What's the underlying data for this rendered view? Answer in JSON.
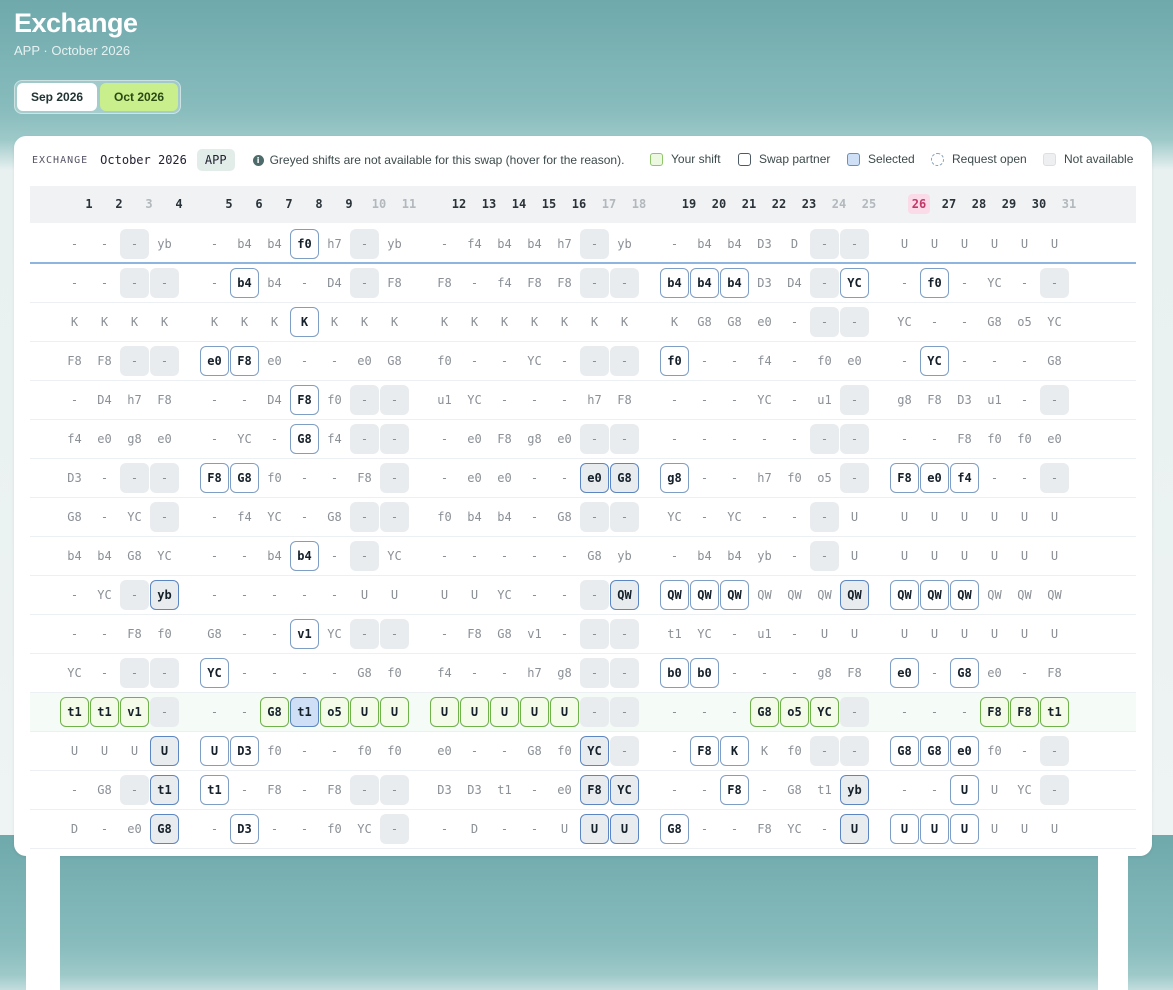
{
  "app": {
    "title": "Exchange",
    "subtitle": "APP · October 2026"
  },
  "month_tabs": [
    {
      "label": "Sep 2026",
      "active": false
    },
    {
      "label": "Oct 2026",
      "active": true
    }
  ],
  "toolbar": {
    "label": "EXCHANGE",
    "month": "October 2026",
    "team": "APP",
    "note": "Greyed shifts are not available for this swap (hover for the reason)."
  },
  "legend": [
    {
      "label": "Your shift",
      "kind": "yours"
    },
    {
      "label": "Swap partner",
      "kind": "partner"
    },
    {
      "label": "Selected",
      "kind": "selected"
    },
    {
      "label": "Request open",
      "kind": "request"
    },
    {
      "label": "Not available",
      "kind": "na"
    }
  ],
  "colors": {
    "accent": "#c9ee8c",
    "today": "#fbdbe7",
    "selected": "#cfe0f6",
    "your_shift_border": "#6fb24a",
    "partner_border": "#7f9ec4"
  },
  "days": [
    {
      "d": "1"
    },
    {
      "d": "2"
    },
    {
      "d": "3",
      "we": true
    },
    {
      "d": "4"
    },
    {
      "d": "5"
    },
    {
      "d": "6"
    },
    {
      "d": "7"
    },
    {
      "d": "8"
    },
    {
      "d": "9"
    },
    {
      "d": "10",
      "we": true
    },
    {
      "d": "11",
      "we": true
    },
    {
      "d": "12"
    },
    {
      "d": "13"
    },
    {
      "d": "14"
    },
    {
      "d": "15"
    },
    {
      "d": "16"
    },
    {
      "d": "17",
      "we": true
    },
    {
      "d": "18",
      "we": true
    },
    {
      "d": "19"
    },
    {
      "d": "20"
    },
    {
      "d": "21"
    },
    {
      "d": "22"
    },
    {
      "d": "23"
    },
    {
      "d": "24",
      "we": true
    },
    {
      "d": "25",
      "we": true
    },
    {
      "d": "26",
      "today": true
    },
    {
      "d": "27"
    },
    {
      "d": "28"
    },
    {
      "d": "29"
    },
    {
      "d": "30"
    },
    {
      "d": "31",
      "we": true
    }
  ],
  "rows": [
    {
      "cells": [
        "-",
        "-",
        "-:n",
        "yb",
        "-",
        "b4",
        "b4",
        "f0:p",
        "h7",
        "-:n",
        "yb",
        "-",
        "f4",
        "b4",
        "b4",
        "h7",
        "-:n",
        "yb",
        "-",
        "b4",
        "b4",
        "D3",
        "D",
        "-:n",
        "-:n",
        "U",
        "U",
        "U",
        "U",
        "U",
        "U"
      ]
    },
    {
      "cells": [
        "-",
        "-",
        "-:n",
        "-:n",
        "-",
        "b4:p",
        "b4",
        "-",
        "D4",
        "-:n",
        "F8",
        "F8",
        "-",
        "f4",
        "F8",
        "F8",
        "-:n",
        "-:n",
        "b4:p",
        "b4:p",
        "b4:p",
        "D3",
        "D4",
        "-:n",
        "YC:p",
        "-",
        "f0:p",
        "-",
        "YC",
        "-",
        "-:n"
      ]
    },
    {
      "cells": [
        "K",
        "K",
        "K",
        "K",
        "K",
        "K",
        "K",
        "K:p",
        "K",
        "K",
        "K",
        "K",
        "K",
        "K",
        "K",
        "K",
        "K",
        "K",
        "K",
        "G8",
        "G8",
        "e0",
        "-",
        "-:n",
        "-:n",
        "YC",
        "-",
        "-",
        "G8",
        "o5",
        "YC"
      ]
    },
    {
      "cells": [
        "F8",
        "F8",
        "-:n",
        "-:n",
        "e0:p",
        "F8:p",
        "e0",
        "-",
        "-",
        "e0",
        "G8",
        "f0",
        "-",
        "-",
        "YC",
        "-",
        "-:n",
        "-:n",
        "f0:p",
        "-",
        "-",
        "f4",
        "-",
        "f0",
        "e0",
        "-",
        "YC:p",
        "-",
        "-",
        "-",
        "G8"
      ]
    },
    {
      "cells": [
        "-",
        "D4",
        "h7",
        "F8",
        "-",
        "-",
        "D4",
        "F8:p",
        "f0",
        "-:n",
        "-:n",
        "u1",
        "YC",
        "-",
        "-",
        "-",
        "h7",
        "F8",
        "-",
        "-",
        "-",
        "YC",
        "-",
        "u1",
        "-:n",
        "g8",
        "F8",
        "D3",
        "u1",
        "-",
        "-:n"
      ]
    },
    {
      "cells": [
        "f4",
        "e0",
        "g8",
        "e0",
        "-",
        "YC",
        "-",
        "G8:p",
        "f4",
        "-:n",
        "-:n",
        "-",
        "e0",
        "F8",
        "g8",
        "e0",
        "-:n",
        "-:n",
        "-",
        "-",
        "-",
        "-",
        "-",
        "-:n",
        "-:n",
        "-",
        "-",
        "F8",
        "f0",
        "f0",
        "e0"
      ]
    },
    {
      "cells": [
        "D3",
        "-",
        "-:n",
        "-:n",
        "F8:p",
        "G8:p",
        "f0",
        "-",
        "-",
        "F8",
        "-:n",
        "-",
        "e0",
        "e0",
        "-",
        "-",
        "e0:s",
        "G8:s",
        "g8:p",
        "-",
        "-",
        "h7",
        "f0",
        "o5",
        "-:n",
        "F8:p",
        "e0:p",
        "f4:p",
        "-",
        "-",
        "-:n"
      ]
    },
    {
      "cells": [
        "G8",
        "-",
        "YC",
        "-:n",
        "-",
        "f4",
        "YC",
        "-",
        "G8",
        "-:n",
        "-:n",
        "f0",
        "b4",
        "b4",
        "-",
        "G8",
        "-:n",
        "-:n",
        "YC",
        "-",
        "YC",
        "-",
        "-",
        "-:n",
        "U",
        "U",
        "U",
        "U",
        "U",
        "U",
        "U"
      ]
    },
    {
      "cells": [
        "b4",
        "b4",
        "G8",
        "YC",
        "-",
        "-",
        "b4",
        "b4:p",
        "-",
        "-:n",
        "YC",
        "-",
        "-",
        "-",
        "-",
        "-",
        "G8",
        "yb",
        "-",
        "b4",
        "b4",
        "yb",
        "-",
        "-:n",
        "U",
        "U",
        "U",
        "U",
        "U",
        "U",
        "U"
      ]
    },
    {
      "cells": [
        "-",
        "YC",
        "-:n",
        "yb:s",
        "-",
        "-",
        "-",
        "-",
        "-",
        "U",
        "U",
        "U",
        "U",
        "YC",
        "-",
        "-",
        "-:n",
        "QW:s",
        "QW:p",
        "QW:p",
        "QW:p",
        "QW",
        "QW",
        "QW",
        "QW:s",
        "QW:p",
        "QW:p",
        "QW:p",
        "QW",
        "QW",
        "QW"
      ]
    },
    {
      "cells": [
        "-",
        "-",
        "F8",
        "f0",
        "G8",
        "-",
        "-",
        "v1:p",
        "YC",
        "-:n",
        "-:n",
        "-",
        "F8",
        "G8",
        "v1",
        "-",
        "-:n",
        "-:n",
        "t1",
        "YC",
        "-",
        "u1",
        "-",
        "U",
        "U",
        "U",
        "U",
        "U",
        "U",
        "U",
        "U"
      ]
    },
    {
      "cells": [
        "YC",
        "-",
        "-:n",
        "-:n",
        "YC:p",
        "-",
        "-",
        "-",
        "-",
        "G8",
        "f0",
        "f4",
        "-",
        "-",
        "h7",
        "g8",
        "-:n",
        "-:n",
        "b0:p",
        "b0:p",
        "-",
        "-",
        "-",
        "g8",
        "F8",
        "e0:p",
        "-",
        "G8:p",
        "e0",
        "-",
        "F8"
      ]
    },
    {
      "mine": true,
      "cells": [
        "t1:y",
        "t1:y",
        "v1:y",
        "-:n",
        "-",
        "-",
        "G8:y",
        "t1:x",
        "o5:y",
        "U:y",
        "U:y",
        "U:y",
        "U:y",
        "U:y",
        "U:y",
        "U:y",
        "-:n",
        "-:n",
        "-",
        "-",
        "-",
        "G8:y",
        "o5:y",
        "YC:y",
        "-:n",
        "-",
        "-",
        "-",
        "F8:y",
        "F8:y",
        "t1:y"
      ]
    },
    {
      "cells": [
        "U",
        "U",
        "U",
        "U:s",
        "U:p",
        "D3:p",
        "f0",
        "-",
        "-",
        "f0",
        "f0",
        "e0",
        "-",
        "-",
        "G8",
        "f0",
        "YC:s",
        "-:n",
        "-",
        "F8:p",
        "K:p",
        "K",
        "f0",
        "-:n",
        "-:n",
        "G8:p",
        "G8:p",
        "e0:p",
        "f0",
        "-",
        "-:n"
      ]
    },
    {
      "cells": [
        "-",
        "G8",
        "-:n",
        "t1:s",
        "t1:p",
        "-",
        "F8",
        "-",
        "F8",
        "-:n",
        "-:n",
        "D3",
        "D3",
        "t1",
        "-",
        "e0",
        "F8:s",
        "YC:s",
        "-",
        "-",
        "F8:p",
        "-",
        "G8",
        "t1",
        "yb:s",
        "-",
        "-",
        "U:p",
        "U",
        "YC",
        "-:n"
      ]
    },
    {
      "cells": [
        "D",
        "-",
        "e0",
        "G8:s",
        "-",
        "D3:p",
        "-",
        "-",
        "f0",
        "YC",
        "-:n",
        "-",
        "D",
        "-",
        "-",
        "U",
        "U:s",
        "U:s",
        "G8:p",
        "-",
        "-",
        "F8",
        "YC",
        "-",
        "U:s",
        "U:p",
        "U:p",
        "U:p",
        "U",
        "U",
        "U"
      ]
    }
  ]
}
